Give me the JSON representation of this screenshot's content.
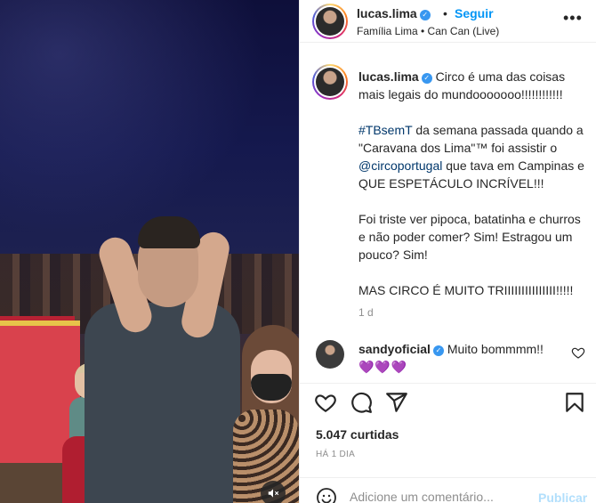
{
  "post": {
    "username": "lucas.lima",
    "follow_label": "Seguir",
    "dot": "•",
    "subtitle": "Família Lima • Can Can (Live)",
    "more_label": "•••"
  },
  "caption": {
    "username": "lucas.lima",
    "line1": "Circo é uma das coisas mais legais do mundooooooo!!!!!!!!!!!!",
    "hashtag": "#TBsemT",
    "p2_a": " da semana passada quando a \"Caravana dos Lima\"™ foi assistir o ",
    "mention": "@circoportugal",
    "p2_b": " que tava em Campinas e QUE ESPETÁCULO INCRÍVEL!!!",
    "p3": "Foi triste ver pipoca, batatinha e churros e não poder comer? Sim! Estragou um pouco? Sim!",
    "p4": "MAS CIRCO É MUITO TRIIIIIIIIIIIIIII!!!!!",
    "time": "1 d"
  },
  "comment": {
    "username": "sandyoficial",
    "text": "Muito bommmm!!",
    "hearts": "💜💜💜"
  },
  "stats": {
    "likes": "5.047 curtidas",
    "ago": "HÁ 1 DIA"
  },
  "composer": {
    "placeholder": "Adicione um comentário...",
    "post_label": "Publicar"
  },
  "colors": {
    "accent": "#0095f6",
    "link": "#00376b",
    "muted": "#8e8e8e"
  },
  "icons": [
    "verified-badge-icon",
    "more-icon",
    "heart-icon",
    "comment-icon",
    "share-icon",
    "bookmark-icon",
    "emoji-icon",
    "mute-icon"
  ]
}
